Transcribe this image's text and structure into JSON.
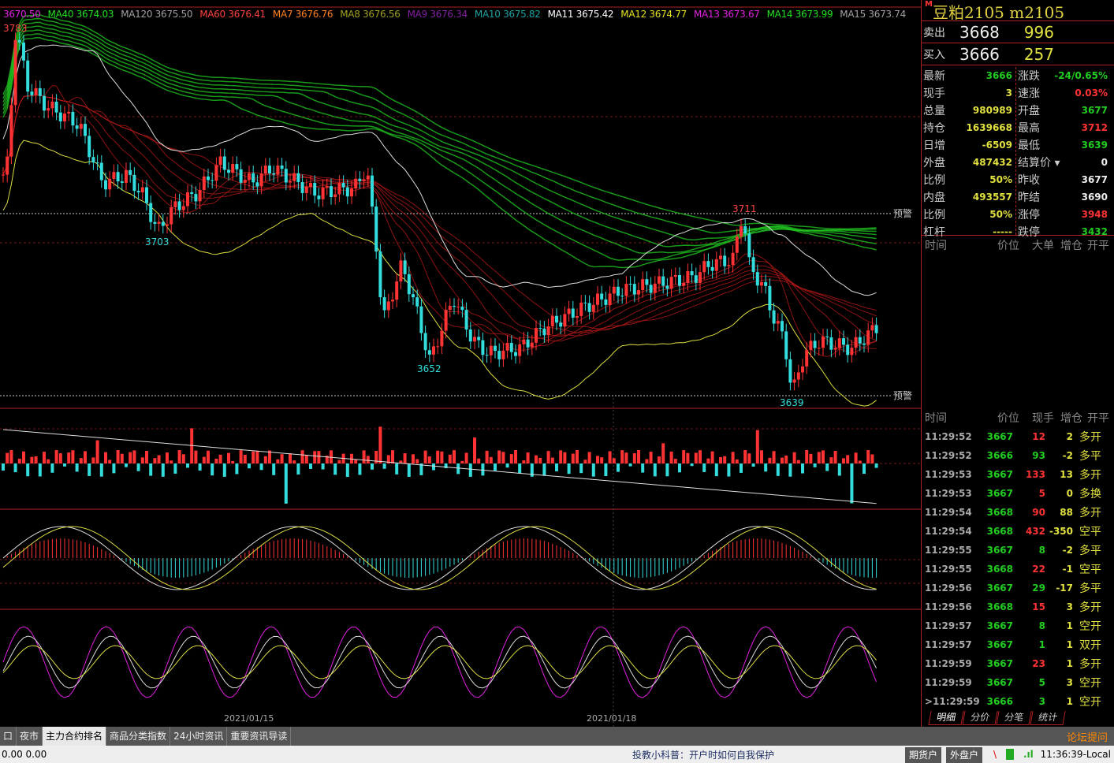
{
  "ma_legend": [
    {
      "label": "3670.50",
      "color": "#e020e0"
    },
    {
      "label": "MA40 3674.03",
      "color": "#20e020"
    },
    {
      "label": "MA120 3675.50",
      "color": "#a0a0a0"
    },
    {
      "label": "MA60 3676.41",
      "color": "#ff4040"
    },
    {
      "label": "MA7 3676.76",
      "color": "#ff8020"
    },
    {
      "label": "MA8 3676.56",
      "color": "#a0a020"
    },
    {
      "label": "MA9 3676.34",
      "color": "#8020a0"
    },
    {
      "label": "MA10 3675.82",
      "color": "#20a0a0"
    },
    {
      "label": "MA11 3675.42",
      "color": "#ffffff"
    },
    {
      "label": "MA12 3674.77",
      "color": "#e0e020"
    },
    {
      "label": "MA13 3673.67",
      "color": "#e020e0"
    },
    {
      "label": "MA14 3673.99",
      "color": "#20e020"
    },
    {
      "label": "MA15 3673.74",
      "color": "#a0a0a0"
    }
  ],
  "chart_labels": {
    "high": "3783",
    "low1": "3703",
    "low2": "3652",
    "peak": "3711",
    "low3": "3639",
    "alert1": "预警",
    "alert2": "预警",
    "date1": "2021/01/15",
    "date2": "2021/01/18"
  },
  "price_path": [
    [
      0,
      3722
    ],
    [
      10,
      3730
    ],
    [
      20,
      3783
    ],
    [
      35,
      3760
    ],
    [
      60,
      3752
    ],
    [
      100,
      3745
    ],
    [
      130,
      3722
    ],
    [
      160,
      3725
    ],
    [
      180,
      3718
    ],
    [
      200,
      3703
    ],
    [
      220,
      3712
    ],
    [
      250,
      3718
    ],
    [
      280,
      3730
    ],
    [
      320,
      3722
    ],
    [
      345,
      3728
    ],
    [
      400,
      3718
    ],
    [
      450,
      3720
    ],
    [
      465,
      3728
    ],
    [
      480,
      3690
    ],
    [
      485,
      3667
    ],
    [
      510,
      3690
    ],
    [
      530,
      3670
    ],
    [
      545,
      3652
    ],
    [
      575,
      3677
    ],
    [
      600,
      3660
    ],
    [
      620,
      3655
    ],
    [
      660,
      3657
    ],
    [
      690,
      3665
    ],
    [
      740,
      3673
    ],
    [
      790,
      3680
    ],
    [
      830,
      3682
    ],
    [
      880,
      3685
    ],
    [
      900,
      3690
    ],
    [
      930,
      3692
    ],
    [
      942,
      3711
    ],
    [
      950,
      3690
    ],
    [
      970,
      3680
    ],
    [
      980,
      3670
    ],
    [
      995,
      3660
    ],
    [
      1005,
      3639
    ],
    [
      1020,
      3655
    ],
    [
      1040,
      3660
    ],
    [
      1080,
      3657
    ],
    [
      1115,
      3666
    ]
  ],
  "quote": {
    "name": "豆粕2105",
    "code": "m2105",
    "market_badge": "M",
    "sell": {
      "label": "卖出",
      "price": "3668",
      "qty": "996"
    },
    "buy": {
      "label": "买入",
      "price": "3666",
      "qty": "257"
    },
    "left": [
      {
        "k": "最新",
        "v": "3666",
        "c": "#2c2"
      },
      {
        "k": "现手",
        "v": "3",
        "c": "#e0e040"
      },
      {
        "k": "总量",
        "v": "980989",
        "c": "#e0e040"
      },
      {
        "k": "持仓",
        "v": "1639668",
        "c": "#e0e040"
      },
      {
        "k": "日增",
        "v": "-6509",
        "c": "#e0e040"
      },
      {
        "k": "外盘",
        "v": "487432",
        "c": "#e0e040"
      },
      {
        "k": "比例",
        "v": "50%",
        "c": "#e0e040"
      },
      {
        "k": "内盘",
        "v": "493557",
        "c": "#e0e040"
      },
      {
        "k": "比例",
        "v": "50%",
        "c": "#e0e040"
      },
      {
        "k": "杠杆",
        "v": "-----",
        "c": "#e0e040"
      }
    ],
    "right": [
      {
        "k": "涨跌",
        "v": "-24/0.65%",
        "c": "#2c2"
      },
      {
        "k": "速涨",
        "v": "0.03%",
        "c": "#f33"
      },
      {
        "k": "开盘",
        "v": "3677",
        "c": "#2c2"
      },
      {
        "k": "最高",
        "v": "3712",
        "c": "#f33"
      },
      {
        "k": "最低",
        "v": "3639",
        "c": "#2c2"
      },
      {
        "k": "结算价 ▾",
        "v": "0",
        "c": "#eee"
      },
      {
        "k": "昨收",
        "v": "3677",
        "c": "#eee"
      },
      {
        "k": "昨结",
        "v": "3690",
        "c": "#eee"
      },
      {
        "k": "涨停",
        "v": "3948",
        "c": "#f33"
      },
      {
        "k": "跌停",
        "v": "3432",
        "c": "#2c2"
      }
    ]
  },
  "bigorder_header": [
    "时间",
    "价位",
    "大单",
    "增仓",
    "开平"
  ],
  "ticks_header": [
    "时间",
    "价位",
    "现手",
    "增仓",
    "开平"
  ],
  "ticks": [
    [
      "11:29:52",
      "3667",
      "12",
      "2",
      "多开",
      "r"
    ],
    [
      "11:29:52",
      "3666",
      "93",
      "-2",
      "多平",
      "g"
    ],
    [
      "11:29:53",
      "3667",
      "133",
      "13",
      "多开",
      "r"
    ],
    [
      "11:29:53",
      "3667",
      "5",
      "0",
      "多换",
      "r"
    ],
    [
      "11:29:54",
      "3668",
      "90",
      "88",
      "多开",
      "r"
    ],
    [
      "11:29:54",
      "3668",
      "432",
      "-350",
      "空平",
      "r"
    ],
    [
      "11:29:55",
      "3667",
      "8",
      "-2",
      "多平",
      "g"
    ],
    [
      "11:29:55",
      "3668",
      "22",
      "-1",
      "空平",
      "r"
    ],
    [
      "11:29:56",
      "3667",
      "29",
      "-17",
      "多平",
      "g"
    ],
    [
      "11:29:56",
      "3668",
      "15",
      "3",
      "多开",
      "r"
    ],
    [
      "11:29:57",
      "3667",
      "8",
      "1",
      "空开",
      "g"
    ],
    [
      "11:29:57",
      "3667",
      "1",
      "1",
      "双开",
      "g"
    ],
    [
      "11:29:59",
      "3667",
      "23",
      "1",
      "多开",
      "r"
    ],
    [
      "11:29:59",
      "3667",
      "5",
      "3",
      "空开",
      "g"
    ],
    [
      ">11:29:59",
      "3666",
      "3",
      "1",
      "空开",
      "g"
    ]
  ],
  "right_tabs": [
    "明细",
    "分价",
    "分笔",
    "统计"
  ],
  "tabbar": {
    "tabs": [
      "口",
      "夜市",
      "主力合约排名",
      "商品分类指数",
      "24小时资讯",
      "重要资讯导读"
    ],
    "active": 2,
    "forum": "论坛提问"
  },
  "status": {
    "nums": "0.00  0.00",
    "tip": "投教小科普：开户时如何自我保护",
    "btn1": "期货户",
    "btn2": "外盘户",
    "clock": "11:36:39-Local"
  }
}
